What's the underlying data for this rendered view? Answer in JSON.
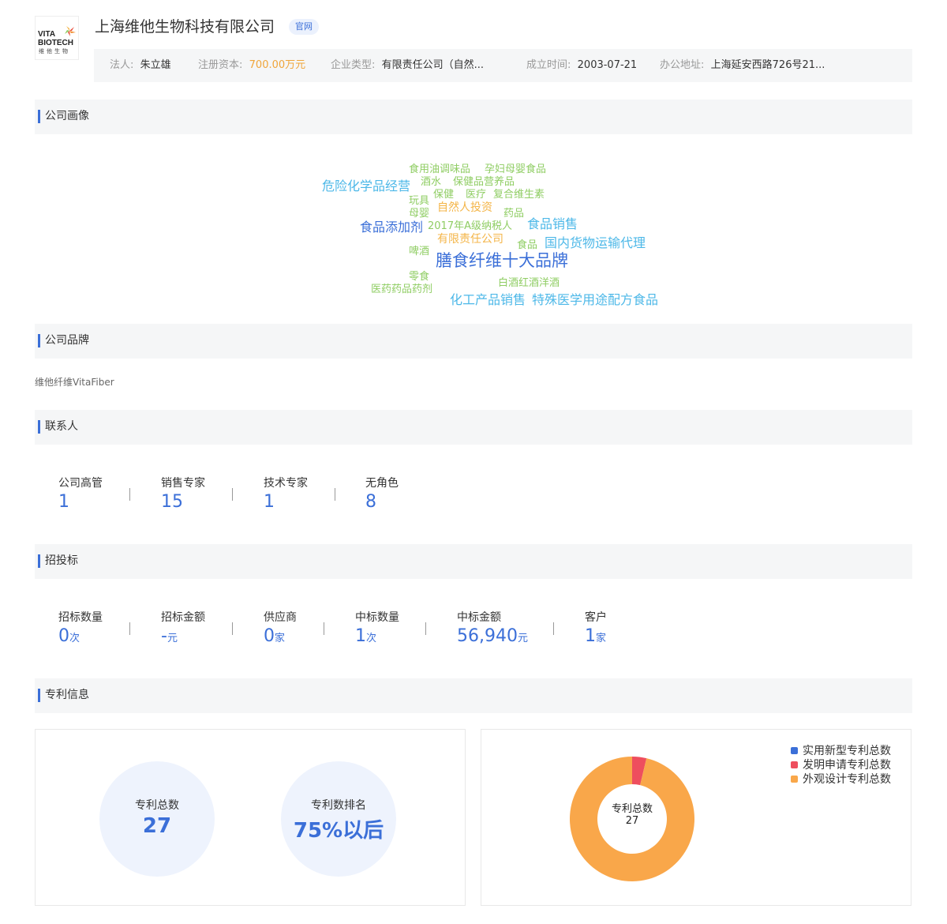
{
  "company": {
    "logo_text_line1": "VITA",
    "logo_text_line2": "BIOTECH",
    "logo_text_line3": "维他生物",
    "name": "上海维他生物科技有限公司",
    "badge": "官网"
  },
  "info": {
    "legal_label": "法人:",
    "legal_value": "朱立雄",
    "capital_label": "注册资本:",
    "capital_value": "700.00万元",
    "type_label": "企业类型:",
    "type_value": "有限责任公司（自然...",
    "date_label": "成立时间:",
    "date_value": "2003-07-21",
    "address_label": "办公地址:",
    "address_value": "上海延安西路726号21..."
  },
  "sections": {
    "portrait": "公司画像",
    "brand": "公司品牌",
    "contacts": "联系人",
    "bidding": "招投标",
    "patents": "专利信息"
  },
  "wordcloud": [
    {
      "text": "食用油调味品",
      "color": "#8fcd63"
    },
    {
      "text": "孕妇母婴食品",
      "color": "#8fcd63"
    },
    {
      "text": "危险化学品经营",
      "color": "#4db8e8"
    },
    {
      "text": "酒水",
      "color": "#8fcd63"
    },
    {
      "text": "保健品营养品",
      "color": "#8fcd63"
    },
    {
      "text": "玩具",
      "color": "#8fcd63"
    },
    {
      "text": "保健",
      "color": "#8fcd63"
    },
    {
      "text": "医疗",
      "color": "#8fcd63"
    },
    {
      "text": "复合维生素",
      "color": "#8fcd63"
    },
    {
      "text": "母婴",
      "color": "#8fcd63"
    },
    {
      "text": "自然人投资",
      "color": "#f4b548"
    },
    {
      "text": "药品",
      "color": "#8fcd63"
    },
    {
      "text": "食品销售",
      "color": "#4db8e8"
    },
    {
      "text": "食品添加剂",
      "color": "#3b6fd8"
    },
    {
      "text": "2017年A级纳税人",
      "color": "#8fcd63"
    },
    {
      "text": "有限责任公司",
      "color": "#f4b548"
    },
    {
      "text": "食品",
      "color": "#8fcd63"
    },
    {
      "text": "国内货物运输代理",
      "color": "#4db8e8"
    },
    {
      "text": "啤酒",
      "color": "#8fcd63"
    },
    {
      "text": "膳食纤维十大品牌",
      "color": "#3b6fd8"
    },
    {
      "text": "零食",
      "color": "#8fcd63"
    },
    {
      "text": "白酒红酒洋酒",
      "color": "#8fcd63"
    },
    {
      "text": "医药药品药剂",
      "color": "#8fcd63"
    },
    {
      "text": "化工产品销售",
      "color": "#4db8e8"
    },
    {
      "text": "特殊医学用途配方食品",
      "color": "#4db8e8"
    }
  ],
  "brand_name": "维他纤维VitaFiber",
  "contacts": [
    {
      "label": "公司高管",
      "value": "1"
    },
    {
      "label": "销售专家",
      "value": "15"
    },
    {
      "label": "技术专家",
      "value": "1"
    },
    {
      "label": "无角色",
      "value": "8"
    }
  ],
  "bidding": [
    {
      "label": "招标数量",
      "value": "0",
      "unit": "次"
    },
    {
      "label": "招标金额",
      "value": "-",
      "unit": "元"
    },
    {
      "label": "供应商",
      "value": "0",
      "unit": "家"
    },
    {
      "label": "中标数量",
      "value": "1",
      "unit": "次"
    },
    {
      "label": "中标金额",
      "value": "56,940",
      "unit": "元"
    },
    {
      "label": "客户",
      "value": "1",
      "unit": "家"
    }
  ],
  "patents": {
    "total_label": "专利总数",
    "total_value": "27",
    "rank_label": "专利数排名",
    "rank_value": "75%以后",
    "donut_center_label": "专利总数",
    "donut_center_value": "27",
    "legend": [
      {
        "name": "实用新型专利总数",
        "color": "#3b6fd8",
        "value": 0
      },
      {
        "name": "发明申请专利总数",
        "color": "#ee4e5e",
        "value": 1
      },
      {
        "name": "外观设计专利总数",
        "color": "#f9a74a",
        "value": 26
      }
    ]
  }
}
